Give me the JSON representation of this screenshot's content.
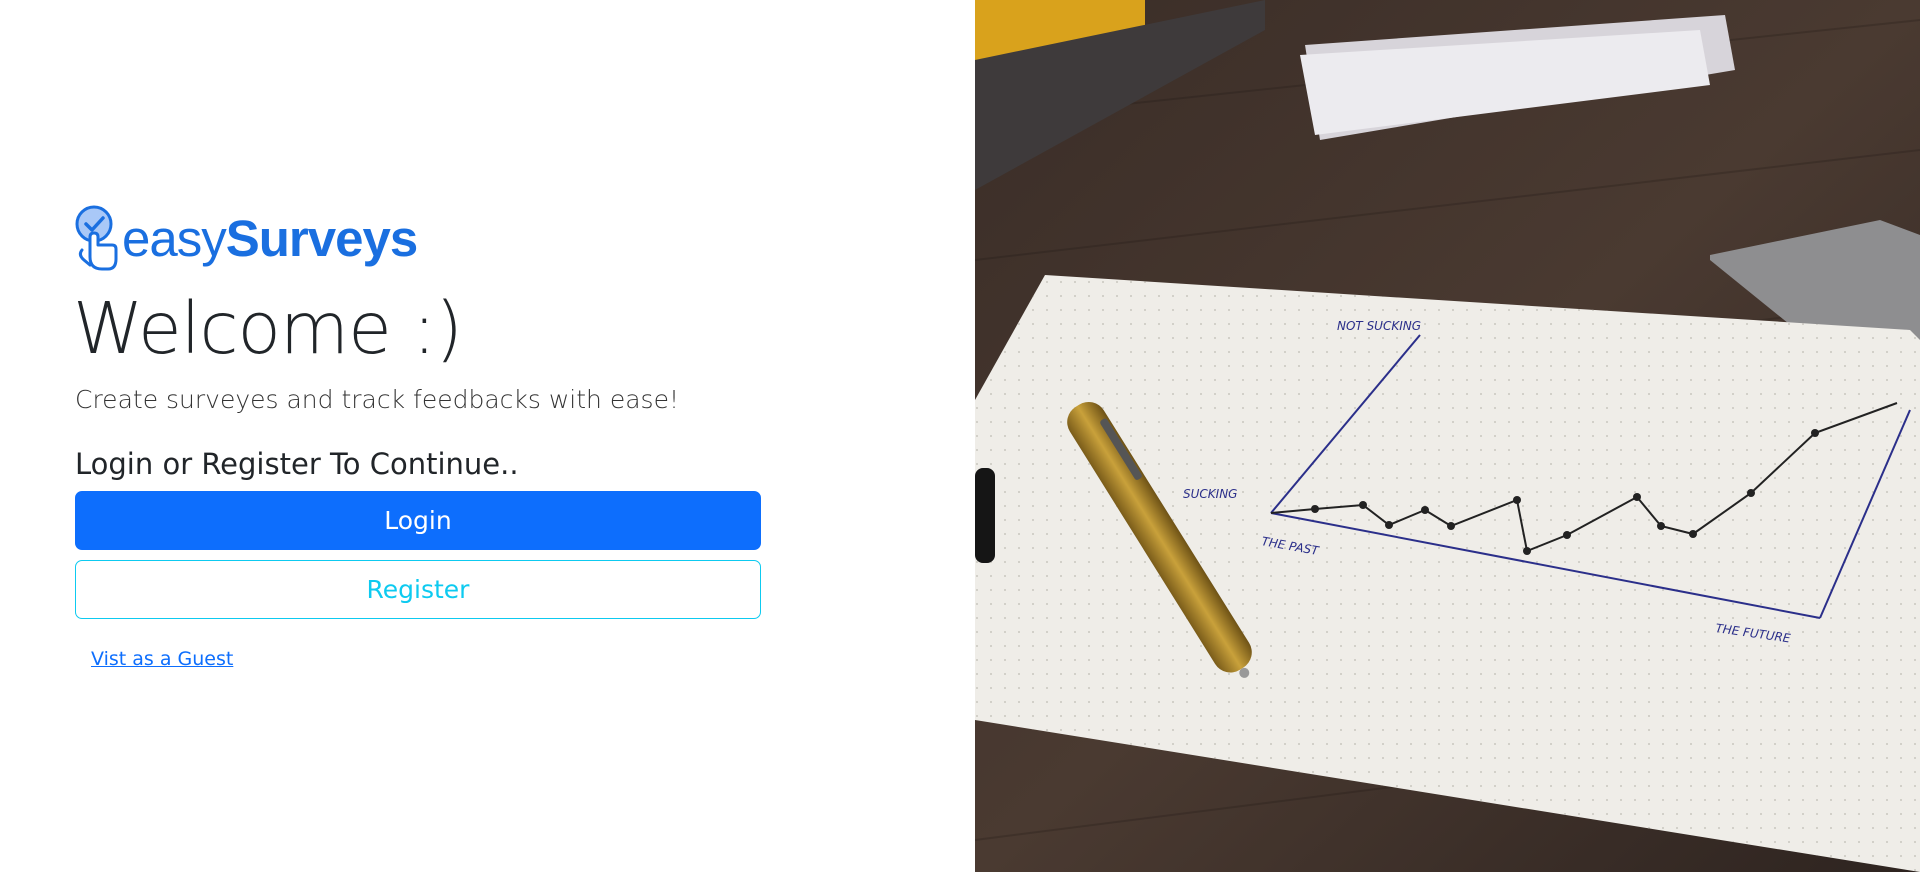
{
  "brand": {
    "name_light": "easy",
    "name_bold": "Surveys",
    "accent": "#1a6fe0",
    "icon": "survey-check-pin-icon"
  },
  "hero": {
    "title": "Welcome :)",
    "tagline": "Create surveyes and track feedbacks with ease!"
  },
  "auth": {
    "prompt": "Login or Register To Continue..",
    "login_label": "Login",
    "register_label": "Register",
    "guest_label": "Vist as a Guest"
  },
  "colors": {
    "primary": "#0d6efd",
    "info": "#0dcaf0",
    "text": "#212529"
  },
  "photo": {
    "labels": {
      "top": "NOT SUCKING",
      "left": "SUCKING",
      "past": "THE PAST",
      "future": "THE FUTURE"
    }
  }
}
